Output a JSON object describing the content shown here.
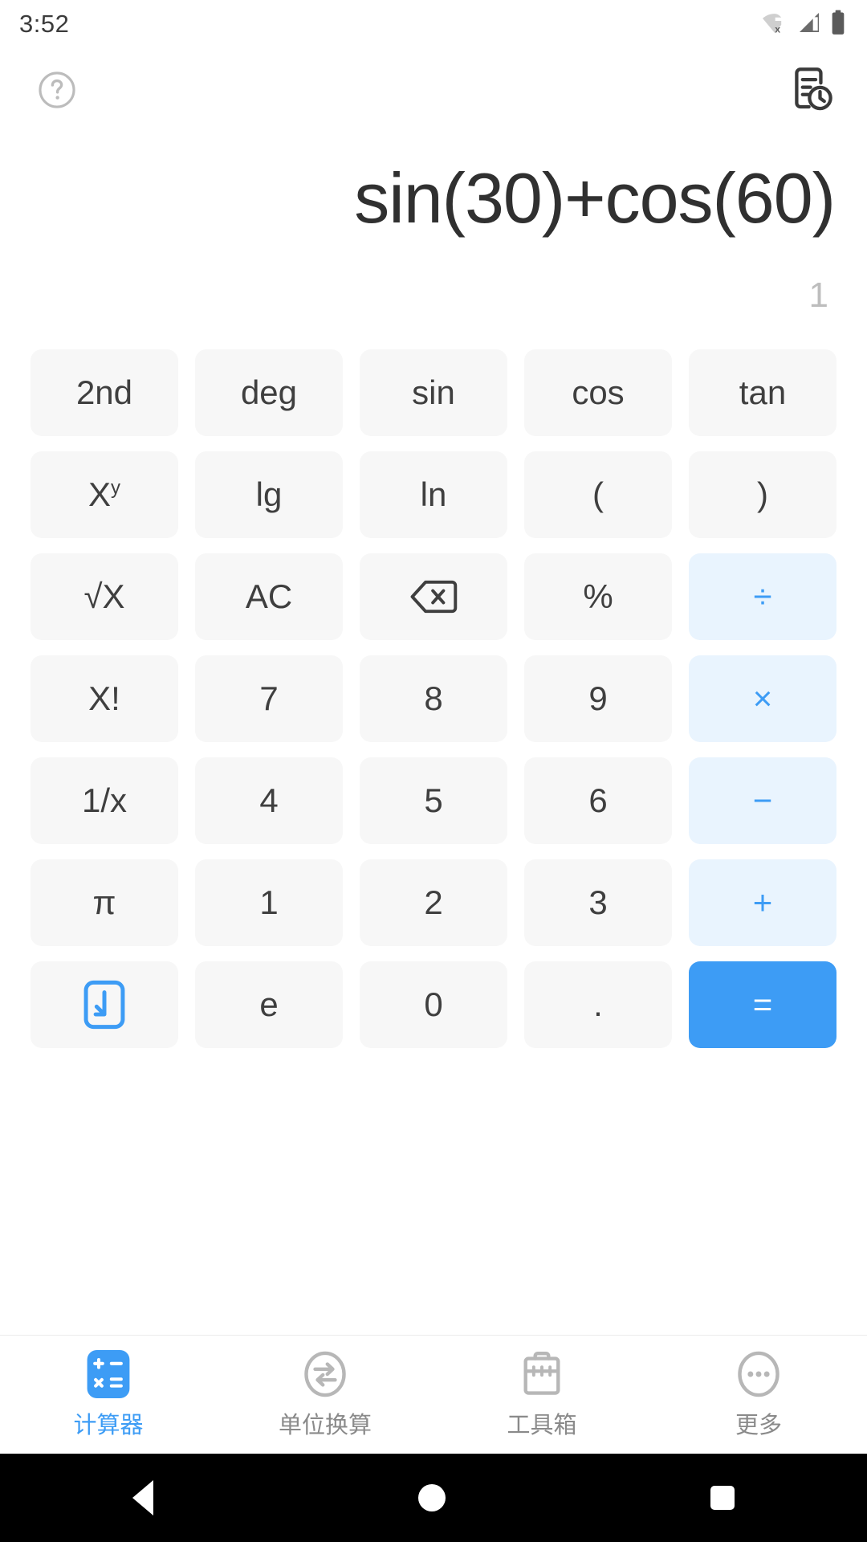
{
  "status_bar": {
    "time": "3:52",
    "icons": [
      "wifi-off-icon",
      "signal-icon",
      "battery-icon"
    ]
  },
  "toolbar": {
    "help_icon": "help-circle-icon",
    "history_icon": "history-document-icon"
  },
  "display": {
    "expression": "sin(30)+cos(60)",
    "result": "1"
  },
  "colors": {
    "accent": "#3d9cf5",
    "operator_bg": "#e9f4fe",
    "key_bg": "#f7f7f7",
    "expression_text": "#303030",
    "result_text": "#bdbdbd"
  },
  "keypad": {
    "rows": [
      [
        {
          "label": "2nd",
          "name": "key-second",
          "style": "normal"
        },
        {
          "label": "deg",
          "name": "key-deg",
          "style": "normal"
        },
        {
          "label": "sin",
          "name": "key-sin",
          "style": "normal"
        },
        {
          "label": "cos",
          "name": "key-cos",
          "style": "normal"
        },
        {
          "label": "tan",
          "name": "key-tan",
          "style": "normal"
        }
      ],
      [
        {
          "label": "X",
          "sup": "y",
          "name": "key-power",
          "style": "normal"
        },
        {
          "label": "lg",
          "name": "key-lg",
          "style": "normal"
        },
        {
          "label": "ln",
          "name": "key-ln",
          "style": "normal"
        },
        {
          "label": "(",
          "name": "key-open-paren",
          "style": "normal"
        },
        {
          "label": ")",
          "name": "key-close-paren",
          "style": "normal"
        }
      ],
      [
        {
          "label": "√X",
          "name": "key-sqrt",
          "style": "normal"
        },
        {
          "label": "AC",
          "name": "key-all-clear",
          "style": "normal"
        },
        {
          "label": "",
          "icon": "backspace-icon",
          "name": "key-backspace",
          "style": "normal"
        },
        {
          "label": "%",
          "name": "key-percent",
          "style": "normal"
        },
        {
          "label": "÷",
          "name": "key-divide",
          "style": "op"
        }
      ],
      [
        {
          "label": "X!",
          "name": "key-factorial",
          "style": "normal"
        },
        {
          "label": "7",
          "name": "key-7",
          "style": "normal"
        },
        {
          "label": "8",
          "name": "key-8",
          "style": "normal"
        },
        {
          "label": "9",
          "name": "key-9",
          "style": "normal"
        },
        {
          "label": "×",
          "name": "key-multiply",
          "style": "op"
        }
      ],
      [
        {
          "label": "1/x",
          "name": "key-reciprocal",
          "style": "normal"
        },
        {
          "label": "4",
          "name": "key-4",
          "style": "normal"
        },
        {
          "label": "5",
          "name": "key-5",
          "style": "normal"
        },
        {
          "label": "6",
          "name": "key-6",
          "style": "normal"
        },
        {
          "label": "−",
          "name": "key-minus",
          "style": "op"
        }
      ],
      [
        {
          "label": "π",
          "name": "key-pi",
          "style": "normal"
        },
        {
          "label": "1",
          "name": "key-1",
          "style": "normal"
        },
        {
          "label": "2",
          "name": "key-2",
          "style": "normal"
        },
        {
          "label": "3",
          "name": "key-3",
          "style": "normal"
        },
        {
          "label": "+",
          "name": "key-plus",
          "style": "op"
        }
      ],
      [
        {
          "label": "",
          "icon": "collapse-keypad-icon",
          "name": "key-collapse",
          "style": "normal"
        },
        {
          "label": "e",
          "name": "key-e",
          "style": "normal"
        },
        {
          "label": "0",
          "name": "key-0",
          "style": "normal"
        },
        {
          "label": ".",
          "name": "key-decimal",
          "style": "normal"
        },
        {
          "label": "=",
          "name": "key-equals",
          "style": "equals"
        }
      ]
    ]
  },
  "bottom_nav": {
    "items": [
      {
        "label": "计算器",
        "name": "nav-calculator",
        "icon": "calculator-icon",
        "active": true
      },
      {
        "label": "单位换算",
        "name": "nav-unit-conversion",
        "icon": "convert-icon",
        "active": false
      },
      {
        "label": "工具箱",
        "name": "nav-toolbox",
        "icon": "toolbox-icon",
        "active": false
      },
      {
        "label": "更多",
        "name": "nav-more",
        "icon": "more-dots-icon",
        "active": false
      }
    ]
  },
  "android_nav": {
    "back": "back-icon",
    "home": "home-icon",
    "recents": "recents-icon"
  }
}
